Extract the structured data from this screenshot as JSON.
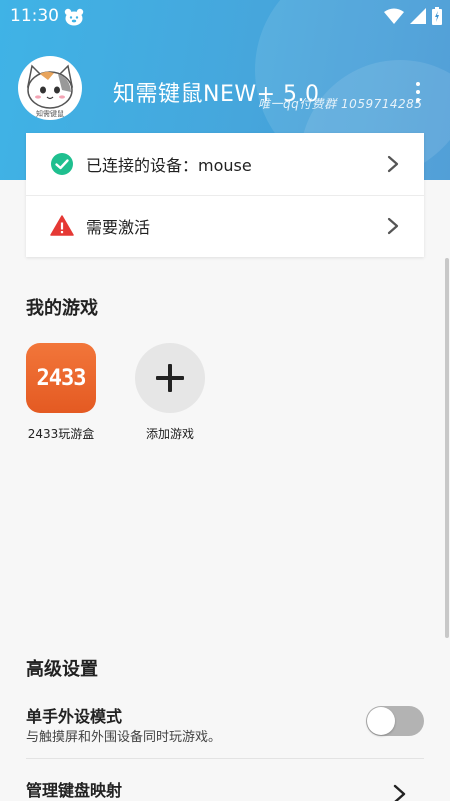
{
  "status_bar": {
    "time": "11:30"
  },
  "header": {
    "title": "知需键鼠NEW+ 5.0",
    "subtitle": "唯一qq付费群 1059714285",
    "avatar_text": "知需键鼠"
  },
  "cards": {
    "connection": {
      "label": "已连接的设备：mouse",
      "icon": "check-circle-icon",
      "icon_color": "#1fbf8f"
    },
    "activation": {
      "label": "需要激活",
      "icon": "warning-icon",
      "icon_color": "#e53935"
    }
  },
  "games": {
    "section_title": "我的游戏",
    "items": [
      {
        "label": "2433玩游盒",
        "icon_text": "2433"
      },
      {
        "label": "添加游戏"
      }
    ]
  },
  "advanced": {
    "section_title": "高级设置",
    "one_hand": {
      "title": "单手外设模式",
      "desc": "与触摸屏和外围设备同时玩游戏。",
      "enabled": false
    },
    "keymap": {
      "title": "管理键盘映射"
    }
  },
  "colors": {
    "header_start": "#3fb3e6",
    "header_end": "#3f95d3",
    "game_icon": "#e45a22"
  }
}
